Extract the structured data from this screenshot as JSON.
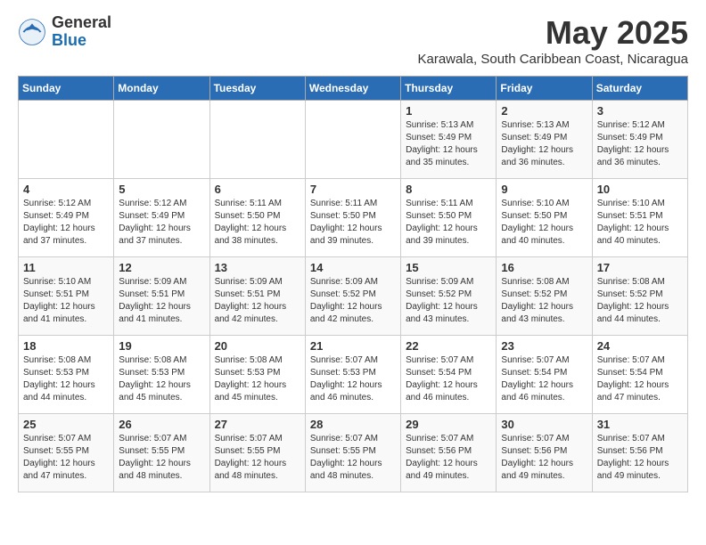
{
  "logo": {
    "general": "General",
    "blue": "Blue"
  },
  "title": "May 2025",
  "subtitle": "Karawala, South Caribbean Coast, Nicaragua",
  "days_of_week": [
    "Sunday",
    "Monday",
    "Tuesday",
    "Wednesday",
    "Thursday",
    "Friday",
    "Saturday"
  ],
  "weeks": [
    [
      {
        "day": "",
        "info": ""
      },
      {
        "day": "",
        "info": ""
      },
      {
        "day": "",
        "info": ""
      },
      {
        "day": "",
        "info": ""
      },
      {
        "day": "1",
        "info": "Sunrise: 5:13 AM\nSunset: 5:49 PM\nDaylight: 12 hours\nand 35 minutes."
      },
      {
        "day": "2",
        "info": "Sunrise: 5:13 AM\nSunset: 5:49 PM\nDaylight: 12 hours\nand 36 minutes."
      },
      {
        "day": "3",
        "info": "Sunrise: 5:12 AM\nSunset: 5:49 PM\nDaylight: 12 hours\nand 36 minutes."
      }
    ],
    [
      {
        "day": "4",
        "info": "Sunrise: 5:12 AM\nSunset: 5:49 PM\nDaylight: 12 hours\nand 37 minutes."
      },
      {
        "day": "5",
        "info": "Sunrise: 5:12 AM\nSunset: 5:49 PM\nDaylight: 12 hours\nand 37 minutes."
      },
      {
        "day": "6",
        "info": "Sunrise: 5:11 AM\nSunset: 5:50 PM\nDaylight: 12 hours\nand 38 minutes."
      },
      {
        "day": "7",
        "info": "Sunrise: 5:11 AM\nSunset: 5:50 PM\nDaylight: 12 hours\nand 39 minutes."
      },
      {
        "day": "8",
        "info": "Sunrise: 5:11 AM\nSunset: 5:50 PM\nDaylight: 12 hours\nand 39 minutes."
      },
      {
        "day": "9",
        "info": "Sunrise: 5:10 AM\nSunset: 5:50 PM\nDaylight: 12 hours\nand 40 minutes."
      },
      {
        "day": "10",
        "info": "Sunrise: 5:10 AM\nSunset: 5:51 PM\nDaylight: 12 hours\nand 40 minutes."
      }
    ],
    [
      {
        "day": "11",
        "info": "Sunrise: 5:10 AM\nSunset: 5:51 PM\nDaylight: 12 hours\nand 41 minutes."
      },
      {
        "day": "12",
        "info": "Sunrise: 5:09 AM\nSunset: 5:51 PM\nDaylight: 12 hours\nand 41 minutes."
      },
      {
        "day": "13",
        "info": "Sunrise: 5:09 AM\nSunset: 5:51 PM\nDaylight: 12 hours\nand 42 minutes."
      },
      {
        "day": "14",
        "info": "Sunrise: 5:09 AM\nSunset: 5:52 PM\nDaylight: 12 hours\nand 42 minutes."
      },
      {
        "day": "15",
        "info": "Sunrise: 5:09 AM\nSunset: 5:52 PM\nDaylight: 12 hours\nand 43 minutes."
      },
      {
        "day": "16",
        "info": "Sunrise: 5:08 AM\nSunset: 5:52 PM\nDaylight: 12 hours\nand 43 minutes."
      },
      {
        "day": "17",
        "info": "Sunrise: 5:08 AM\nSunset: 5:52 PM\nDaylight: 12 hours\nand 44 minutes."
      }
    ],
    [
      {
        "day": "18",
        "info": "Sunrise: 5:08 AM\nSunset: 5:53 PM\nDaylight: 12 hours\nand 44 minutes."
      },
      {
        "day": "19",
        "info": "Sunrise: 5:08 AM\nSunset: 5:53 PM\nDaylight: 12 hours\nand 45 minutes."
      },
      {
        "day": "20",
        "info": "Sunrise: 5:08 AM\nSunset: 5:53 PM\nDaylight: 12 hours\nand 45 minutes."
      },
      {
        "day": "21",
        "info": "Sunrise: 5:07 AM\nSunset: 5:53 PM\nDaylight: 12 hours\nand 46 minutes."
      },
      {
        "day": "22",
        "info": "Sunrise: 5:07 AM\nSunset: 5:54 PM\nDaylight: 12 hours\nand 46 minutes."
      },
      {
        "day": "23",
        "info": "Sunrise: 5:07 AM\nSunset: 5:54 PM\nDaylight: 12 hours\nand 46 minutes."
      },
      {
        "day": "24",
        "info": "Sunrise: 5:07 AM\nSunset: 5:54 PM\nDaylight: 12 hours\nand 47 minutes."
      }
    ],
    [
      {
        "day": "25",
        "info": "Sunrise: 5:07 AM\nSunset: 5:55 PM\nDaylight: 12 hours\nand 47 minutes."
      },
      {
        "day": "26",
        "info": "Sunrise: 5:07 AM\nSunset: 5:55 PM\nDaylight: 12 hours\nand 48 minutes."
      },
      {
        "day": "27",
        "info": "Sunrise: 5:07 AM\nSunset: 5:55 PM\nDaylight: 12 hours\nand 48 minutes."
      },
      {
        "day": "28",
        "info": "Sunrise: 5:07 AM\nSunset: 5:55 PM\nDaylight: 12 hours\nand 48 minutes."
      },
      {
        "day": "29",
        "info": "Sunrise: 5:07 AM\nSunset: 5:56 PM\nDaylight: 12 hours\nand 49 minutes."
      },
      {
        "day": "30",
        "info": "Sunrise: 5:07 AM\nSunset: 5:56 PM\nDaylight: 12 hours\nand 49 minutes."
      },
      {
        "day": "31",
        "info": "Sunrise: 5:07 AM\nSunset: 5:56 PM\nDaylight: 12 hours\nand 49 minutes."
      }
    ]
  ]
}
